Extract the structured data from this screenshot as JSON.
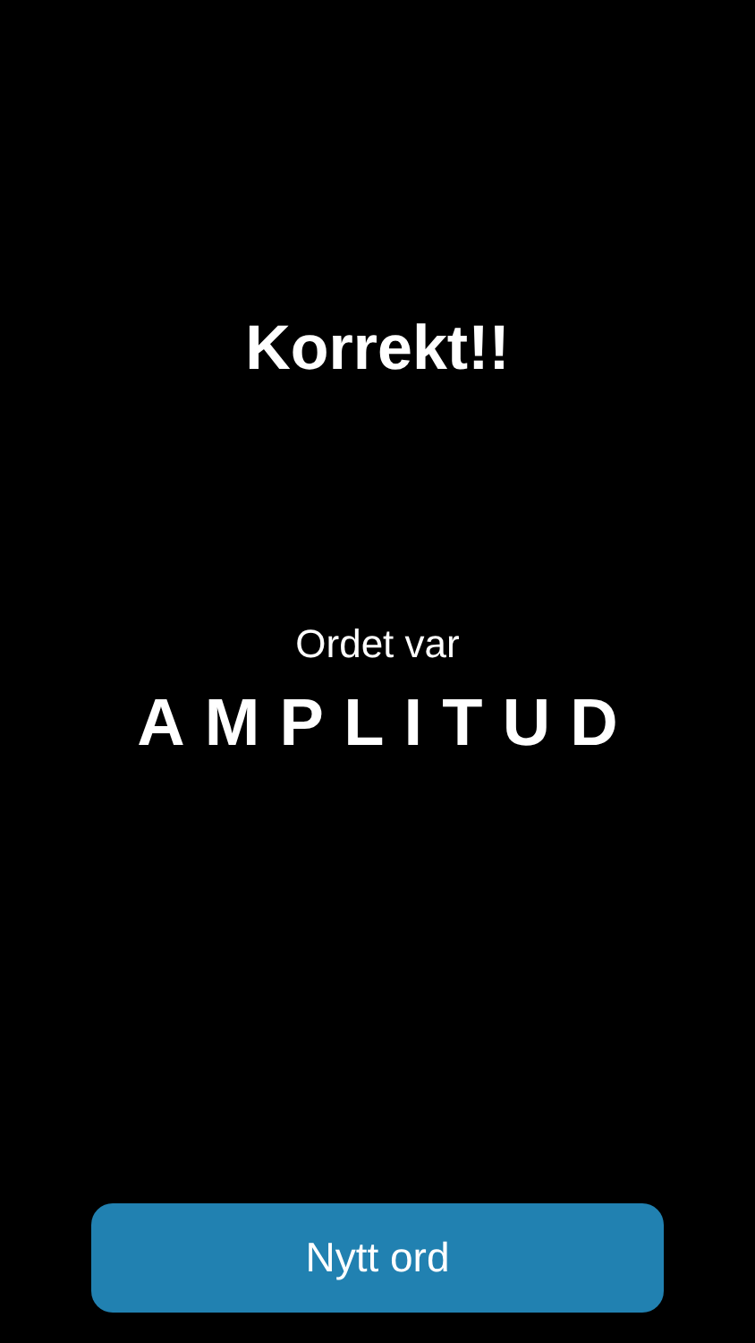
{
  "result": {
    "title": "Korrekt!!",
    "caption": "Ordet var",
    "word": "AMPLITUD"
  },
  "button": {
    "label": "Nytt ord"
  }
}
